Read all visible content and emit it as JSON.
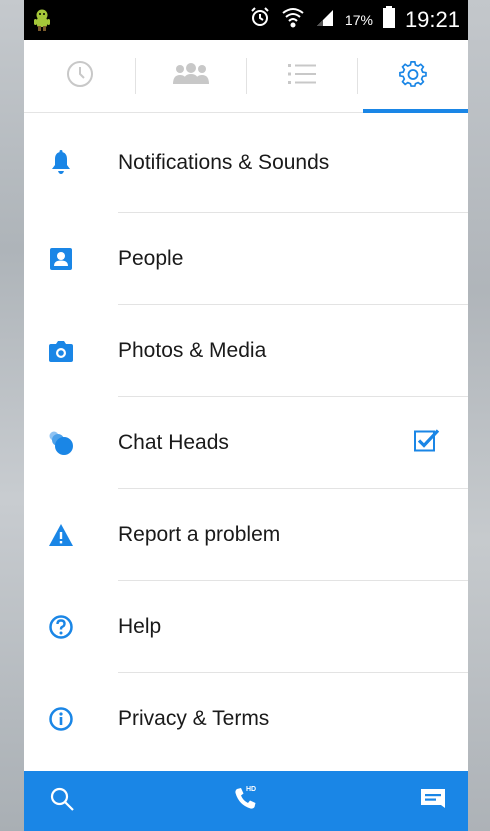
{
  "status_bar": {
    "battery_percent": "17%",
    "time": "19:21"
  },
  "tabs": [
    {
      "name": "recent",
      "icon": "clock-icon",
      "active": false
    },
    {
      "name": "groups",
      "icon": "groups-icon",
      "active": false
    },
    {
      "name": "list",
      "icon": "list-icon",
      "active": false
    },
    {
      "name": "settings",
      "icon": "gear-icon",
      "active": true
    }
  ],
  "settings": {
    "items": [
      {
        "label": "Notifications & Sounds",
        "icon": "bell-icon"
      },
      {
        "label": "People",
        "icon": "person-icon"
      },
      {
        "label": "Photos & Media",
        "icon": "camera-icon"
      },
      {
        "label": "Chat Heads",
        "icon": "chat-heads-icon",
        "checked": true
      },
      {
        "label": "Report a problem",
        "icon": "warning-icon"
      },
      {
        "label": "Help",
        "icon": "help-icon"
      },
      {
        "label": "Privacy & Terms",
        "icon": "info-icon"
      }
    ]
  },
  "bottom_bar": {
    "call_badge": "HD"
  },
  "colors": {
    "accent": "#1a86e6",
    "status_bar": "#000000",
    "inactive_icon": "#c8c8c8"
  }
}
